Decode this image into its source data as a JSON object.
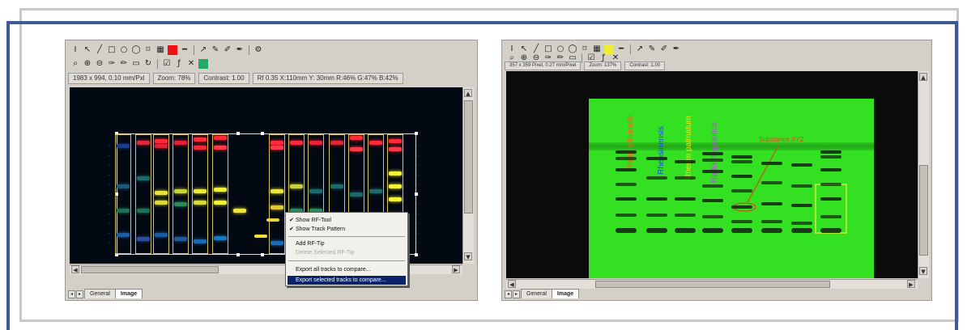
{
  "left_window": {
    "status": [
      "1983 x 994, 0.10 mm/Pxl",
      "Zoom: 78%",
      "Contrast: 1.00",
      "Rf 0.35  X:110mm Y: 30mm  R:46% G:47% B:42%"
    ],
    "context_menu": {
      "items": [
        {
          "label": "Show RF-Tool",
          "checked": true
        },
        {
          "label": "Show Track Pattern",
          "checked": true
        },
        {
          "label": "Add RF-Tip"
        },
        {
          "label": "Delete Selected RF-Tip",
          "disabled": true
        },
        {
          "label": "Export all tracks to compare..."
        },
        {
          "label": "Export selected tracks to compare...",
          "highlighted": true
        }
      ]
    },
    "tabs": [
      "General",
      "Image"
    ],
    "active_tab": "Image"
  },
  "right_window": {
    "status": [
      "357 x 359 Pixel, 0.27 mm/Pixel",
      "Zoom: 137%",
      "Contrast: 1.00"
    ],
    "lane_labels": [
      {
        "text": "Radix officinale",
        "color": "#e86a1a"
      },
      {
        "text": "Rheosinensis",
        "color": "#1a4ee8"
      },
      {
        "text": "Rheum palmatum",
        "color": "#e8e81a"
      },
      {
        "text": "Radix rhapontica",
        "color": "#a35cc8"
      }
    ],
    "annotation": "Substance XYZ",
    "tabs": [
      "General",
      "Image"
    ],
    "active_tab": "Image"
  },
  "colors": {
    "frame_blue": "#3d5a93",
    "plate_green": "#33e022",
    "menu_highlight": "#0a246a"
  }
}
